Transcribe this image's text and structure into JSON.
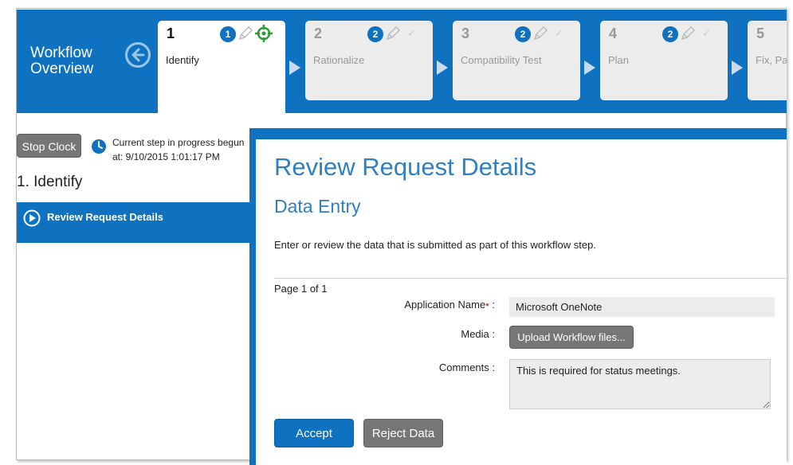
{
  "workflow": {
    "title_line1": "Workflow",
    "title_line2": "Overview",
    "steps": [
      {
        "number": "1",
        "name": "Identify",
        "badge": "1",
        "active": true
      },
      {
        "number": "2",
        "name": "Rationalize",
        "badge": "2",
        "active": false
      },
      {
        "number": "3",
        "name": "Compatibility Test",
        "badge": "2",
        "active": false
      },
      {
        "number": "4",
        "name": "Plan",
        "badge": "2",
        "active": false
      },
      {
        "number": "5",
        "name": "Fix, Pac",
        "badge": "",
        "active": false
      }
    ]
  },
  "sidebar": {
    "stop_clock_label": "Stop Clock",
    "clock_text_line1": "Current step in progress begun",
    "clock_text_line2": "at: 9/10/2015 1:01:17 PM",
    "step_heading": "1. Identify",
    "nav_item_label": "Review Request Details"
  },
  "main": {
    "title": "Review Request Details",
    "subtitle": "Data Entry",
    "description": "Enter or review the data that is submitted as part of this workflow step.",
    "page_info": "Page 1 of 1",
    "fields": {
      "app_name_label": "Application Name",
      "app_name_required": "•",
      "app_name_colon": " :",
      "app_name_value": "Microsoft OneNote",
      "media_label": "Media :",
      "upload_label": "Upload Workflow files...",
      "comments_label": "Comments :",
      "comments_value": "This is required for status meetings."
    },
    "accept_label": "Accept",
    "reject_label": "Reject Data"
  },
  "colors": {
    "brand_blue": "#0e72c1",
    "title_blue": "#2f7fc1",
    "button_gray": "#767676",
    "target_green": "#2e9a35"
  },
  "icons": [
    "back-arrow-icon",
    "pencil-icon",
    "check-icon",
    "target-icon",
    "clock-icon",
    "play-icon"
  ]
}
